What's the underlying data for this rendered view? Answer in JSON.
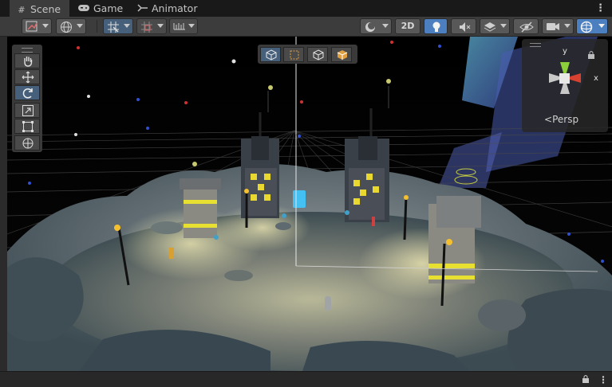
{
  "tabs": [
    {
      "label": "Scene",
      "icon": "grid-icon"
    },
    {
      "label": "Game",
      "icon": "gamepad-icon"
    },
    {
      "label": "Animator",
      "icon": "animator-icon"
    }
  ],
  "toolbar": {
    "mode_2d_label": "2D"
  },
  "scene_gizmo": {
    "axis_x": "x",
    "axis_y": "y",
    "projection_label": "Persp"
  },
  "tools": [
    "hand-tool",
    "move-tool",
    "rotate-tool",
    "scale-tool",
    "rect-tool",
    "transform-tool"
  ],
  "colors": {
    "tab_active": "#3c3c3c",
    "toolbar": "#3c3c3c",
    "selected_blue": "#46607c",
    "light_on_blue": "#4b7fc0",
    "axis_x_red": "#d6422f",
    "axis_y_green": "#8ccf3a"
  }
}
